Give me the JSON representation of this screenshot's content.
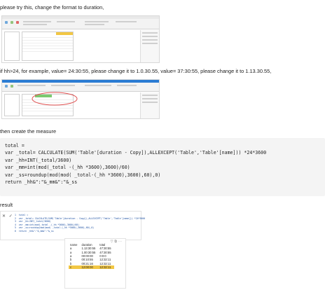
{
  "paragraphs": {
    "p1": "please try this, change the format to duration,",
    "p2": "if hh>24, for example, value= 24:30:55, please change it to 1.0.30.55, value= 37:30:55, please change it to 1.13.30.55,",
    "p3": "then create the measure",
    "p4": "result"
  },
  "code_lines": [
    "total =",
    "var _total= CALCULATE(SUM('Table'[duration - Copy]),ALLEXCEPT('Table','Table'[name])) *24*3600",
    "var _hh=INT(_total/3600)",
    "var _mm=int(mod(_total -(_hh *3600),3600)/60)",
    "var _ss=roundup(mod(mod( _total-(_hh *3600),3600),60),0)",
    "return _hh&\":\"&_mm&\":\"&_ss"
  ],
  "formula_bar": {
    "cancel_label": "✕",
    "commit_label": "✓",
    "lines": [
      "1  total =",
      "2  var _total= CALCULATE(SUM('Table'[duration - Copy]),ALLEXCEPT('Table','Table'[name])) *24*3600",
      "3  var _hh=INT(_total/3600)",
      "4  var _mm=int(mod(_total -(_hh *3600),3600)/60)",
      "5  var _ss=roundup(mod(mod( _total-(_hh *3600),3600),60),0)",
      "6  return _hh&\":\"&_mm&\":\"&_ss"
    ]
  },
  "result_table": {
    "headers": [
      "name",
      "duration",
      "total"
    ],
    "rows": [
      [
        "a",
        "1.13:30:55",
        "47:30:55"
      ],
      [
        "a",
        "1.00:30:55",
        "47:30:55"
      ],
      [
        "a",
        "00:00:00",
        "0:0:0"
      ],
      [
        "b",
        "00:10:55",
        "12:32:11"
      ],
      [
        "b",
        "00:21:16",
        "12:32:11"
      ],
      [
        "c",
        "12:00:00",
        "12:32:11"
      ]
    ]
  },
  "colors": {
    "accent": "#f2c744",
    "annotation": "#e05050",
    "code_bg": "#f4f4f4"
  }
}
